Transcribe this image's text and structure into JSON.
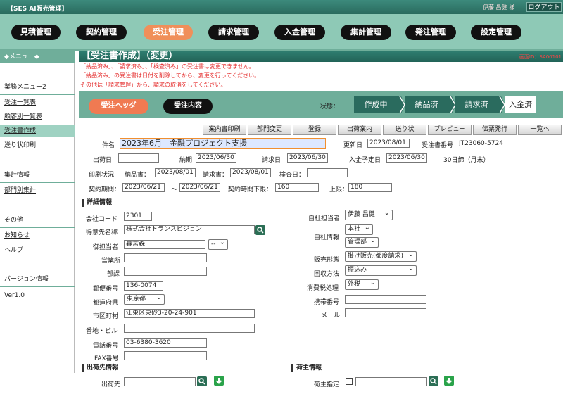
{
  "app": {
    "title": "【SES AI販売管理】",
    "user": "伊藤 昌健 様",
    "logout": "ログアウト"
  },
  "nav": [
    "見積管理",
    "契約管理",
    "受注管理",
    "請求管理",
    "入金管理",
    "集計管理",
    "発注管理",
    "設定管理"
  ],
  "sidebar": {
    "header": "◆メニュー◆",
    "group1": "業務メニュー2",
    "items1": [
      "受注一覧表",
      "顧客別一覧表",
      "受注書作成",
      "送り状印刷"
    ],
    "group2": "集計情報",
    "items2": [
      "部門別集計"
    ],
    "group3": "その他",
    "items3": [
      "お知らせ",
      "ヘルプ"
    ],
    "group4": "バージョン情報",
    "version": "Ver1.0"
  },
  "page": {
    "title": "【受注書作成】（変更）",
    "screen_id": "画面ID：SA00101",
    "warnings": [
      "「納品済み」、「請求済み」、「検査済み」の受注書は変更できません。",
      "「納品済み」の受注書は日付を削除してから、変更を行ってください。",
      "その他は「請求管理」から、請求の取消をしてください。"
    ]
  },
  "tabs": {
    "header": "受注ヘッダ",
    "detail": "受注内容"
  },
  "status": {
    "label": "状態：",
    "steps": [
      "作成中",
      "納品済",
      "請求済",
      "入金済"
    ]
  },
  "toolbar": [
    "案内書印刷",
    "部門変更",
    "登録",
    "出荷案内",
    "送り状",
    "プレビュー",
    "伝票発行",
    "一覧へ"
  ],
  "header_fields": {
    "name_label": "件名",
    "name_value": "2023年6月　金融プロジェクト支援",
    "updated_label": "更新日",
    "updated_value": "2023/08/01",
    "order_no_label": "受注書番号",
    "order_no_value": "JT23060-5724",
    "ship_label": "出荷日",
    "ship_value": "",
    "due_label": "納期",
    "due_value": "2023/06/30",
    "bill_label": "請求日",
    "bill_value": "2023/06/30",
    "pay_label": "入金予定日",
    "pay_value": "2023/06/30",
    "close_text": "30日締（月末）",
    "print_label": "印刷状況",
    "dn_label": "納品書：",
    "dn_value": "2023/08/01",
    "inv_label": "請求書：",
    "inv_value": "2023/08/01",
    "insp_label": "検査日：",
    "insp_value": "",
    "period_label": "契約期間：",
    "period_from": "2023/06/21",
    "period_sep": "〜",
    "period_to": "2023/06/21",
    "hours_low_label": "契約時間下限：",
    "hours_low_value": "160",
    "hours_up_label": "上限：",
    "hours_up_value": "180"
  },
  "detail": {
    "section": "詳細情報",
    "company_code_label": "会社コード",
    "company_code": "2301",
    "customer_label": "得意先名称",
    "customer": "株式会社トランスビジョン",
    "contact_label": "御担当者",
    "contact": "暮宮森",
    "contact_select": "--",
    "office_label": "営業所",
    "office": "",
    "dept_label": "部課",
    "dept": "",
    "zip_label": "郵便番号",
    "zip": "136-0074",
    "pref_label": "都道府県",
    "pref": "東京都",
    "city_label": "市区町村",
    "city": "江東区東砂3-20-24-901",
    "addr_label": "番地・ビル",
    "addr": "",
    "tel_label": "電話番号",
    "tel": "03-6380-3620",
    "fax_label": "FAX番号",
    "fax": "",
    "staff_label": "自社担当者",
    "staff": "伊藤 昌健",
    "own_label": "自社情報",
    "own_branch": "本社",
    "own_dept": "管理部",
    "sales_label": "販売形態",
    "sales": "掛け販売(都度請求)",
    "collect_label": "回収方法",
    "collect": "振込み",
    "tax_label": "消費税処理",
    "tax": "外税",
    "mobile_label": "携帯番号",
    "mobile": "",
    "mail_label": "メール",
    "mail": ""
  },
  "shipping": {
    "section": "出荷先情報",
    "label": "出荷先",
    "value": ""
  },
  "consignor": {
    "section": "荷主情報",
    "label": "荷主指定",
    "value": ""
  }
}
